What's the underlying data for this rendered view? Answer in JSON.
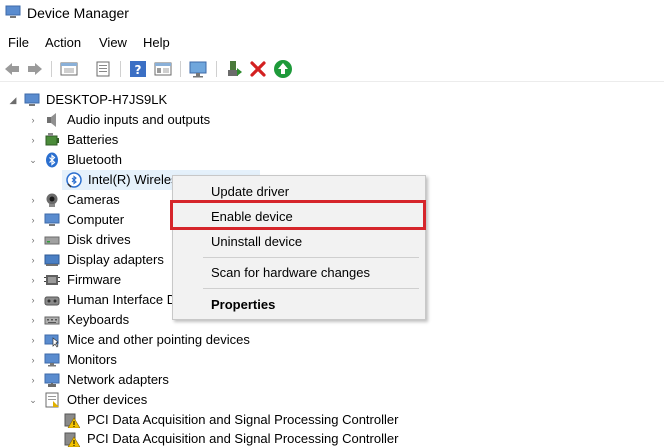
{
  "window": {
    "title": "Device Manager"
  },
  "menu": [
    "File",
    "Action",
    "View",
    "Help"
  ],
  "toolbar": {
    "buttons": [
      "back-icon",
      "forward-icon",
      "properties-pane-icon",
      "list-view-icon",
      "help-icon",
      "details-icon",
      "monitor-scan-icon",
      "update-driver-icon",
      "uninstall-icon",
      "enable-icon"
    ]
  },
  "tree": {
    "root": "DESKTOP-H7JS9LK",
    "items": [
      {
        "label": "Audio inputs and outputs",
        "icon": "speaker-icon"
      },
      {
        "label": "Batteries",
        "icon": "battery-icon"
      },
      {
        "label": "Bluetooth",
        "icon": "bluetooth-icon",
        "expanded": true
      },
      {
        "label": "Intel(R) Wireles",
        "icon": "bluetooth-device-icon",
        "child": true
      },
      {
        "label": "Cameras",
        "icon": "camera-icon"
      },
      {
        "label": "Computer",
        "icon": "computer-icon"
      },
      {
        "label": "Disk drives",
        "icon": "disk-icon"
      },
      {
        "label": "Display adapters",
        "icon": "display-adapter-icon"
      },
      {
        "label": "Firmware",
        "icon": "firmware-icon"
      },
      {
        "label": "Human Interface D",
        "icon": "hid-icon"
      },
      {
        "label": "Keyboards",
        "icon": "keyboard-icon"
      },
      {
        "label": "Mice and other pointing devices",
        "icon": "mouse-icon"
      },
      {
        "label": "Monitors",
        "icon": "monitor-icon"
      },
      {
        "label": "Network adapters",
        "icon": "network-icon"
      },
      {
        "label": "Other devices",
        "icon": "other-devices-icon",
        "expanded": true
      },
      {
        "label": "PCI Data Acquisition and Signal Processing Controller",
        "icon": "warning-device-icon",
        "child": true
      },
      {
        "label": "PCI Data Acquisition and Signal Processing Controller",
        "icon": "warning-device-icon",
        "child": true
      }
    ]
  },
  "context_menu": {
    "items": [
      "Update driver",
      "Enable device",
      "Uninstall device",
      "Scan for hardware changes",
      "Properties"
    ],
    "highlighted": "Enable device"
  },
  "colors": {
    "highlight": "#d6262b",
    "selection": "#e5f1fb",
    "menu_bg": "#f2f2f2"
  }
}
